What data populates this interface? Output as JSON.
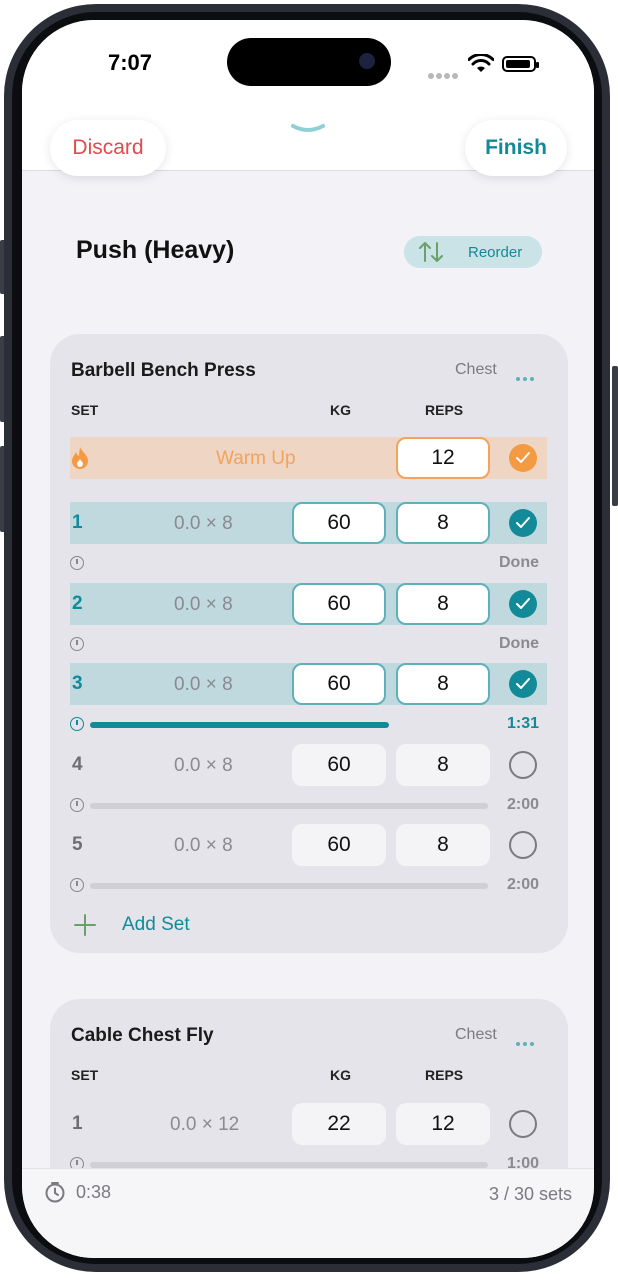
{
  "status": {
    "time": "7:07"
  },
  "topbar": {
    "discard_label": "Discard",
    "finish_label": "Finish"
  },
  "routine": {
    "title": "Push (Heavy)",
    "reorder_label": "Reorder"
  },
  "exercises": [
    {
      "name": "Barbell Bench Press",
      "muscle": "Chest",
      "headers": {
        "set": "SET",
        "kg": "KG",
        "reps": "REPS"
      },
      "warmup": {
        "label": "Warm Up",
        "reps": "12"
      },
      "sets": [
        {
          "num": "1",
          "prev": "0.0 × 8",
          "kg": "60",
          "reps": "8",
          "rest": "Done"
        },
        {
          "num": "2",
          "prev": "0.0 × 8",
          "kg": "60",
          "reps": "8",
          "rest": "Done"
        },
        {
          "num": "3",
          "prev": "0.0 × 8",
          "kg": "60",
          "reps": "8",
          "rest": "1:31",
          "rest_progress": 0.75
        },
        {
          "num": "4",
          "prev": "0.0 × 8",
          "kg": "60",
          "reps": "8",
          "rest": "2:00"
        },
        {
          "num": "5",
          "prev": "0.0 × 8",
          "kg": "60",
          "reps": "8",
          "rest": "2:00"
        }
      ],
      "add_set_label": "Add Set"
    },
    {
      "name": "Cable Chest Fly",
      "muscle": "Chest",
      "headers": {
        "set": "SET",
        "kg": "KG",
        "reps": "REPS"
      },
      "sets": [
        {
          "num": "1",
          "prev": "0.0 × 12",
          "kg": "22",
          "reps": "12",
          "rest": "1:00"
        }
      ]
    }
  ],
  "footer": {
    "elapsed": "0:38",
    "sets_progress": "3 / 30 sets"
  },
  "colors": {
    "accent": "#138a98",
    "danger": "#e5484d",
    "warmup": "#f39a43"
  }
}
